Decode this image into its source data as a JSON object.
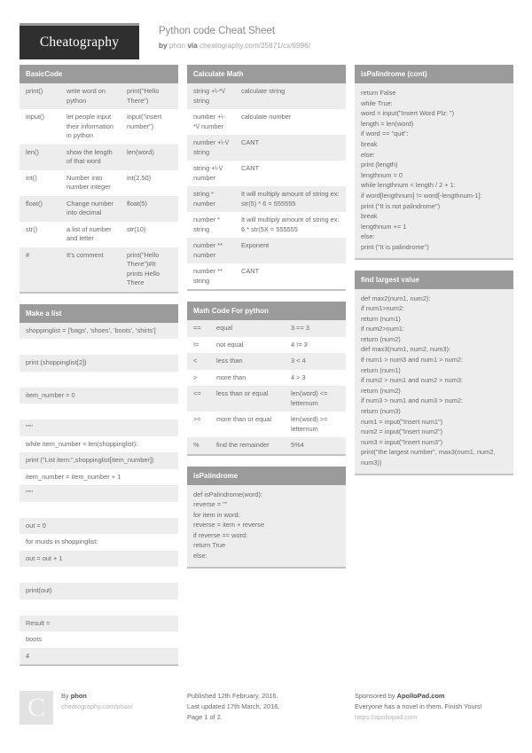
{
  "header": {
    "logo_text": "Cheatography",
    "title": "Python code Cheat Sheet",
    "by_label": "by",
    "author": "phon",
    "via_label": "via",
    "source_url": "cheatography.com/25871/cs/6996/"
  },
  "cards": {
    "basic_code": {
      "title": "BasicCode",
      "rows": [
        {
          "key": "print()",
          "desc": "write word on python",
          "value": "print(\"Hello There\")"
        },
        {
          "key": "input()",
          "desc": "let people input their information in python",
          "value": "input(\"insert number\")"
        },
        {
          "key": "len()",
          "desc": "show the length of that word",
          "value": "len(word)"
        },
        {
          "key": "int()",
          "desc": "Number into number integer",
          "value": "int(2.50)"
        },
        {
          "key": "float()",
          "desc": "Change number into decimal",
          "value": "float(5)"
        },
        {
          "key": "str()",
          "desc": "a list of number and letter",
          "value": "str(10)"
        },
        {
          "key": "#",
          "desc": "It's comment",
          "value": "print(\"Hello There\")#It prints Hello There"
        }
      ]
    },
    "make_a_list": {
      "title": "Make a list",
      "lines": [
        "shoppinglist = ['bags', 'shoes', 'boots', 'shirts']",
        "",
        "print (shoppinglist[2])",
        "",
        "item_number = 0",
        "",
        "\"\"\"",
        "while item_number < len(shoppinglist):",
        "print (\"List item:\",shoppinglist[item_number])",
        "item_number = item_number + 1",
        "\"\"\"",
        "",
        "out = 0",
        "for muids in shoppinglist:",
        "out = out + 1",
        "",
        "print(out)",
        "",
        "Result =",
        "boots",
        "4"
      ]
    },
    "calculate_math": {
      "title": "Calculate Math",
      "rows": [
        {
          "key": "string +\\-*\\/ string",
          "value": "calculate string"
        },
        {
          "key": "number +\\-*\\/ number",
          "value": "calculate number"
        },
        {
          "key": "number +\\-\\/ string",
          "value": "CANT"
        },
        {
          "key": "string +\\-\\/ number",
          "value": "CANT"
        },
        {
          "key": "string * number",
          "value": "It will multiply amount of string ex: str(5) * 6 = 555555"
        },
        {
          "key": "number * string",
          "value": "It will multiply amount of string ex: 6 * str(5X = 555555"
        },
        {
          "key": "number ** number",
          "value": "Exponent"
        },
        {
          "key": "number ** string",
          "value": "CANT"
        }
      ]
    },
    "math_code": {
      "title": "Math Code For python",
      "rows": [
        {
          "op": "==",
          "desc": "equal",
          "example": "3 == 3"
        },
        {
          "op": "!=",
          "desc": "not equal",
          "example": "4 != 3"
        },
        {
          "op": "<",
          "desc": "less than",
          "example": "3 < 4"
        },
        {
          "op": ">",
          "desc": "more than",
          "example": "4 > 3"
        },
        {
          "op": "<=",
          "desc": "less than or equal",
          "example": "len(word) <= letternum"
        },
        {
          "op": ">=",
          "desc": "more than or equal",
          "example": "len(word) >= letternum"
        },
        {
          "op": "%",
          "desc": "find the remainder",
          "example": "5%4"
        }
      ]
    },
    "is_palindrome": {
      "title": "isPalindrome",
      "lines": [
        "def isPalindrome(word):",
        "reverse = \"\"",
        "for item in word:",
        "reverse = item + reverse",
        "if reverse == word:",
        "return True",
        "else:"
      ]
    },
    "is_palindrome_cont": {
      "title": "isPalindrome (cont)",
      "lines": [
        "return False",
        "while True:",
        "word = input(\"Insert Word Plz: \")",
        "length = len(word)",
        "if word == \"quit\":",
        "break",
        "else:",
        "print (length)",
        "lengthnum = 0",
        "while lengthnum < length / 2 + 1:",
        "if word[lengthnum] != word[-lengthnum-1]:",
        "print (\"It is not palindrome\")",
        "break",
        "lengthnum += 1",
        "else:",
        "print (\"It is palindrome\")"
      ]
    },
    "find_largest": {
      "title": "find largest value",
      "lines": [
        "def max2(num1, num2):",
        "if num1>num2:",
        "return (num1)",
        "if num2>num1:",
        "return (num2)",
        "def max3(num1, num2, num3):",
        "if num1 > num3 and num1 > num2:",
        "return (num1)",
        "if num2 > num1 and num2 > num3:",
        "return (num2)",
        "if num3 > num1 and num3 > num2:",
        "return (num3)",
        "num1 = input(\"Insert num1\")",
        "num2 = input(\"Insert num2\")",
        "num3 = input(\"Insert num3\")",
        "print(\"the largest number\", max3(num1, num2, num3))"
      ]
    }
  },
  "footer": {
    "avatar_letter": "C",
    "by_label": "By",
    "author": "phon",
    "author_url": "cheatography.com/phon/",
    "published": "Published 12th February, 2016.",
    "updated": "Last updated 17th March, 2016.",
    "page_info": "Page 1 of 2.",
    "sponsor_prefix": "Sponsored by",
    "sponsor_name": "ApolloPad.com",
    "sponsor_tagline": "Everyone has a novel in them. Finish Yours!",
    "sponsor_url": "https://apollopad.com"
  }
}
